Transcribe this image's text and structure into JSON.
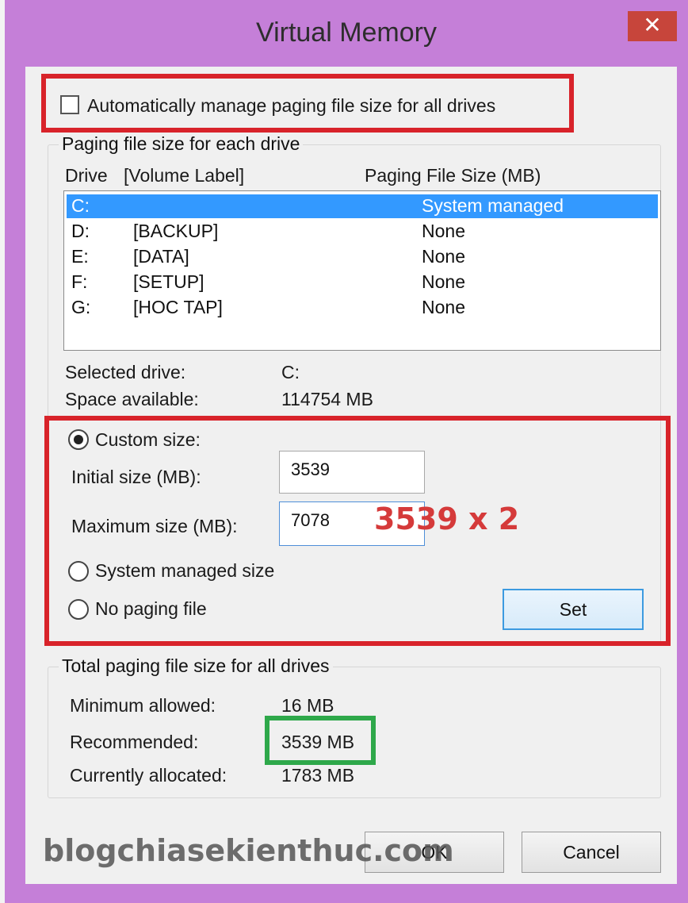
{
  "window": {
    "title": "Virtual Memory",
    "close_glyph": "✕"
  },
  "auto_manage": {
    "label": "Automatically manage paging file size for all drives",
    "checked": false
  },
  "paging_group": {
    "legend": "Paging file size for each drive",
    "col_drive": "Drive",
    "col_label": "[Volume Label]",
    "col_size": "Paging File Size (MB)",
    "drives": [
      {
        "drive": "C:",
        "label": "",
        "size": "System managed",
        "selected": true
      },
      {
        "drive": "D:",
        "label": "[BACKUP]",
        "size": "None",
        "selected": false
      },
      {
        "drive": "E:",
        "label": "[DATA]",
        "size": "None",
        "selected": false
      },
      {
        "drive": "F:",
        "label": "[SETUP]",
        "size": "None",
        "selected": false
      },
      {
        "drive": "G:",
        "label": "[HOC TAP]",
        "size": "None",
        "selected": false
      }
    ],
    "selected_drive_label": "Selected drive:",
    "selected_drive_value": "C:",
    "space_label": "Space available:",
    "space_value": "114754 MB",
    "custom_size_label": "Custom size:",
    "initial_label": "Initial size (MB):",
    "initial_value": "3539",
    "max_label": "Maximum size (MB):",
    "max_value": "7078",
    "system_managed_label": "System managed size",
    "no_paging_label": "No paging file",
    "set_label": "Set",
    "selected_option": "custom"
  },
  "annotation": {
    "text": "3539 x 2",
    "color": "#d53a3a"
  },
  "total_group": {
    "legend": "Total paging file size for all drives",
    "min_label": "Minimum allowed:",
    "min_value": "16 MB",
    "rec_label": "Recommended:",
    "rec_value": "3539 MB",
    "alloc_label": "Currently allocated:",
    "alloc_value": "1783 MB"
  },
  "buttons": {
    "ok_label": "OK",
    "cancel_label": "Cancel"
  },
  "watermark": "blogchiasekienthuc.com",
  "colors": {
    "highlight_red": "#d8232a",
    "highlight_green": "#2ea84a",
    "selection": "#3399ff",
    "frame": "#c57fd8"
  }
}
